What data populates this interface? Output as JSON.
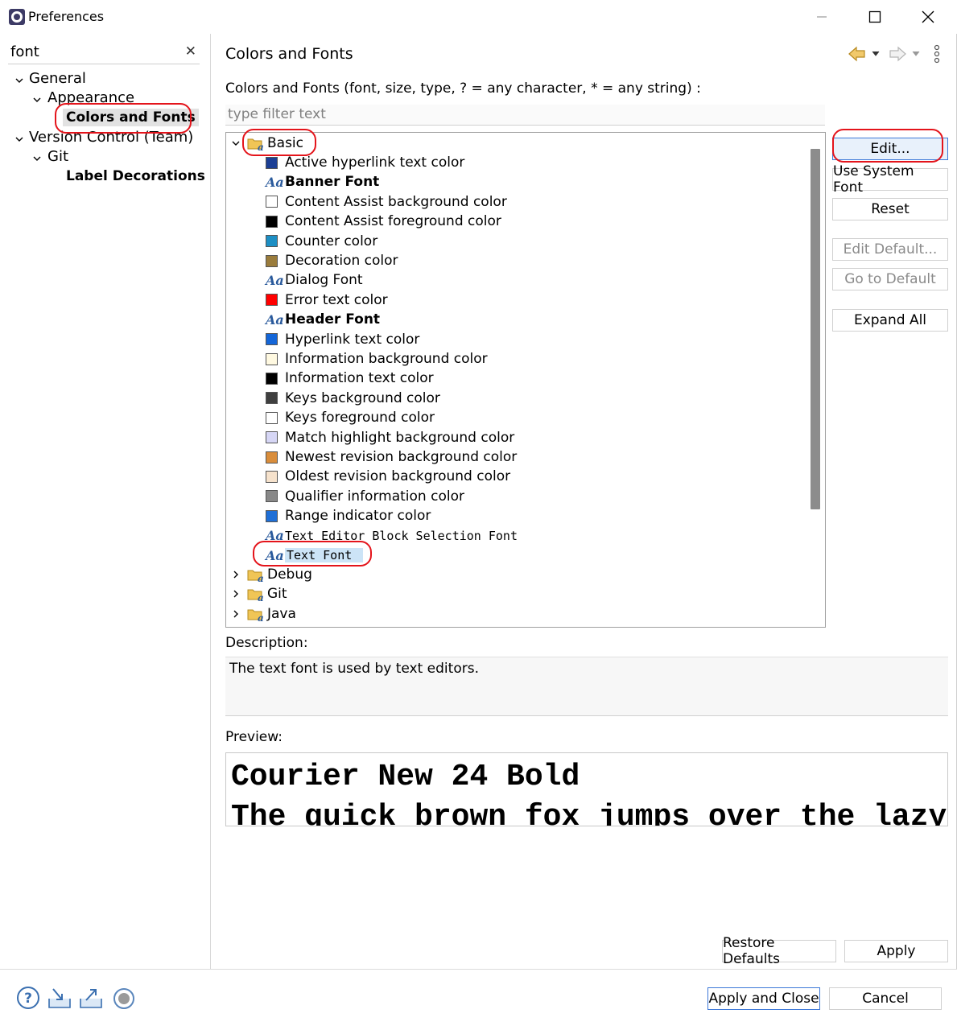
{
  "window": {
    "title": "Preferences"
  },
  "nav": {
    "filter_value": "font",
    "items": [
      {
        "label": "General"
      },
      {
        "label": "Appearance"
      },
      {
        "label": "Colors and Fonts"
      },
      {
        "label": "Version Control (Team)"
      },
      {
        "label": "Git"
      },
      {
        "label": "Label Decorations"
      }
    ]
  },
  "page": {
    "title": "Colors and Fonts",
    "instructions": "Colors and Fonts (font, size, type, ? = any character, * = any string) :",
    "filter_placeholder": "type filter text"
  },
  "tree": {
    "root": "Basic",
    "items": [
      {
        "label": "Active hyperlink text color",
        "kind": "color",
        "color": "#1c3f94"
      },
      {
        "label": "Banner Font",
        "kind": "font",
        "style": "bold"
      },
      {
        "label": "Content Assist background color",
        "kind": "color",
        "color": "#ffffff"
      },
      {
        "label": "Content Assist foreground color",
        "kind": "color",
        "color": "#000000"
      },
      {
        "label": "Counter color",
        "kind": "color",
        "color": "#1d8fc4"
      },
      {
        "label": "Decoration color",
        "kind": "color",
        "color": "#9a7c3c"
      },
      {
        "label": "Dialog Font",
        "kind": "font",
        "style": "normal"
      },
      {
        "label": "Error text color",
        "kind": "color",
        "color": "#ff0000"
      },
      {
        "label": "Header Font",
        "kind": "font",
        "style": "bold"
      },
      {
        "label": "Hyperlink text color",
        "kind": "color",
        "color": "#1466d8"
      },
      {
        "label": "Information background color",
        "kind": "color",
        "color": "#fff9e1"
      },
      {
        "label": "Information text color",
        "kind": "color",
        "color": "#000000"
      },
      {
        "label": "Keys background color",
        "kind": "color",
        "color": "#3f3f3f"
      },
      {
        "label": "Keys foreground color",
        "kind": "color",
        "color": "#ffffff"
      },
      {
        "label": "Match highlight background color",
        "kind": "color",
        "color": "#d6d6f5"
      },
      {
        "label": "Newest revision background color",
        "kind": "color",
        "color": "#d98d3b"
      },
      {
        "label": "Oldest revision background color",
        "kind": "color",
        "color": "#f6e2cc"
      },
      {
        "label": "Qualifier information color",
        "kind": "color",
        "color": "#888888"
      },
      {
        "label": "Range indicator color",
        "kind": "color",
        "color": "#1f6fd6"
      },
      {
        "label": "Text Editor Block Selection Font",
        "kind": "font",
        "style": "mono"
      },
      {
        "label": "Text Font",
        "kind": "font",
        "style": "mono-selected"
      }
    ],
    "collapsed": [
      "Debug",
      "Git",
      "Java"
    ]
  },
  "buttons": {
    "edit": "Edit...",
    "use_system_font": "Use System Font",
    "reset": "Reset",
    "edit_default": "Edit Default...",
    "go_to_default": "Go to Default",
    "expand_all": "Expand All",
    "restore_defaults": "Restore Defaults",
    "apply": "Apply",
    "apply_and_close": "Apply and Close",
    "cancel": "Cancel"
  },
  "description": {
    "label": "Description:",
    "text": "The text font is used by text editors."
  },
  "preview": {
    "label": "Preview:",
    "line1": "Courier New 24 Bold",
    "line2": "The quick brown fox jumps over the lazy dog."
  }
}
